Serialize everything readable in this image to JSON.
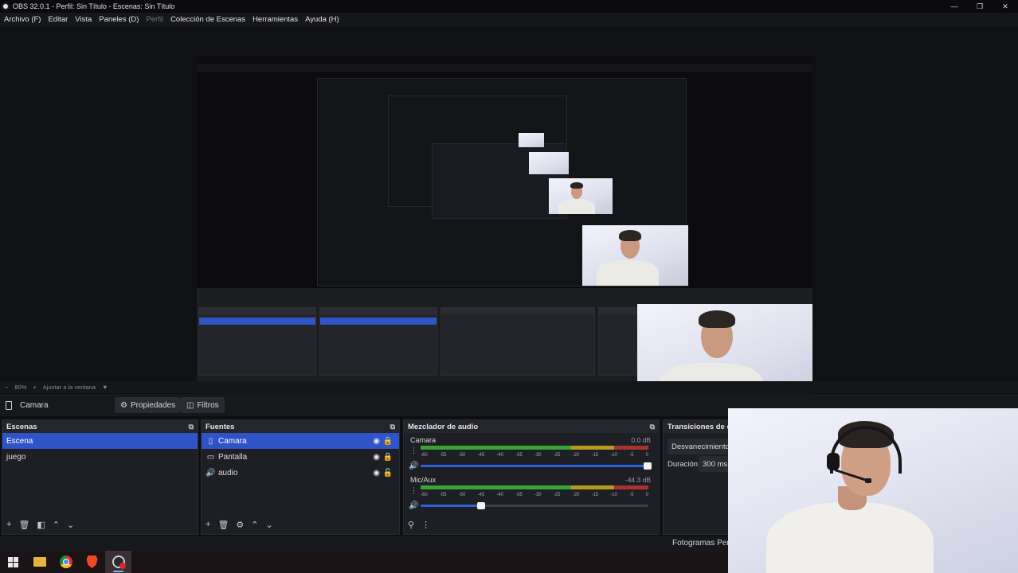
{
  "window": {
    "title": "OBS 32.0.1 - Perfil: Sin Título - Escenas: Sin Título",
    "minimize_glyph": "—",
    "maximize_glyph": "❐",
    "close_glyph": "✕"
  },
  "menu": {
    "items": [
      "Archivo (F)",
      "Editar",
      "Vista",
      "Paneles (D)",
      "Perfil",
      "Colección de Escenas",
      "Herramientas",
      "Ayuda (H)"
    ]
  },
  "preview_footer": {
    "zoom_minus": "−",
    "zoom_value": "80%",
    "zoom_plus": "+",
    "fit_label": "Ajustar a la ventana",
    "fit_arrow": "▼"
  },
  "context_bar": {
    "source_name": "Camara",
    "properties_label": "Propiedades",
    "filters_label": "Filtros",
    "properties_icon": "gear-icon",
    "filters_icon": "filter-icon"
  },
  "scenes": {
    "title": "Escenas",
    "items": [
      "Escena",
      "juego"
    ],
    "selected": 0
  },
  "sources": {
    "title": "Fuentes",
    "items": [
      {
        "name": "Camara",
        "icon": "camera-icon"
      },
      {
        "name": "Pantalla",
        "icon": "monitor-icon"
      },
      {
        "name": "audio",
        "icon": "speaker-icon"
      }
    ],
    "selected": 0
  },
  "mixer": {
    "title": "Mezclador de audio",
    "scale": [
      "-60",
      "-55",
      "-50",
      "-45",
      "-40",
      "-35",
      "-30",
      "-25",
      "-20",
      "-15",
      "-10",
      "-5",
      "0"
    ],
    "channels": [
      {
        "name": "Camara",
        "db": "0.0 dB",
        "volume": 1.0
      },
      {
        "name": "Mic/Aux",
        "db": "-44.3 dB",
        "volume": 0.27
      }
    ]
  },
  "transitions": {
    "title": "Transiciones de es",
    "selected": "Desvanecimiento",
    "duration_label": "Duración",
    "duration_value": "300 ms"
  },
  "status": {
    "fps_label": "Fotogramas Perdi"
  },
  "taskbar": {
    "items": [
      "windows-start-icon",
      "file-explorer-icon",
      "chrome-icon",
      "brave-icon",
      "obs-icon"
    ],
    "active": "obs-icon"
  },
  "colors": {
    "accent_selection": "#2e54c8",
    "meter_green": "#39a334",
    "meter_yellow": "#b59a22",
    "meter_red": "#a83232",
    "fader_blue": "#2d62d9"
  }
}
